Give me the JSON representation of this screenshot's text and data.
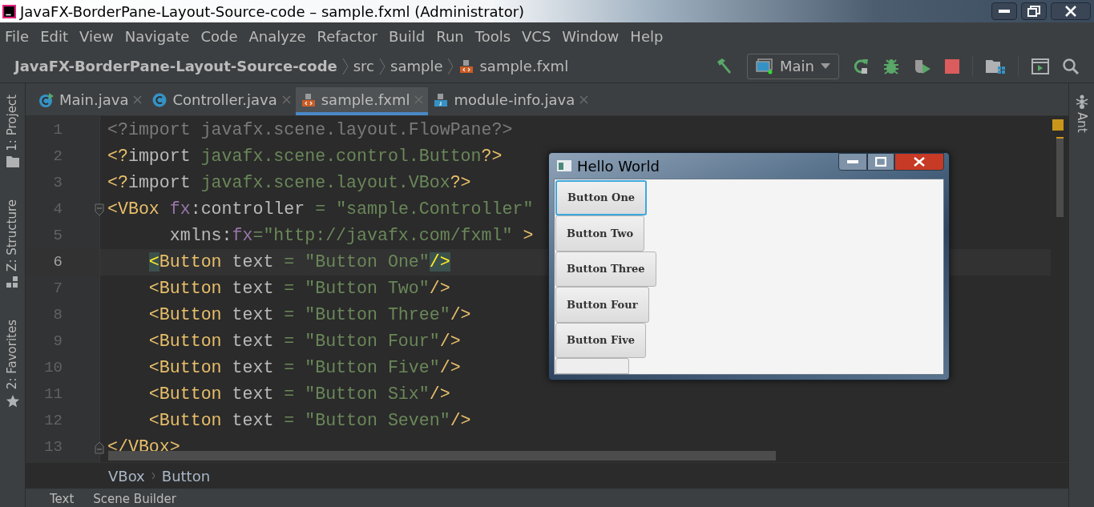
{
  "window": {
    "title": "JavaFX-BorderPane-Layout-Source-code – sample.fxml (Administrator)"
  },
  "menu": [
    "File",
    "Edit",
    "View",
    "Navigate",
    "Code",
    "Analyze",
    "Refactor",
    "Build",
    "Run",
    "Tools",
    "VCS",
    "Window",
    "Help"
  ],
  "navigation": [
    {
      "label": "JavaFX-BorderPane-Layout-Source-code",
      "kind": "project"
    },
    {
      "label": "src",
      "kind": "folder"
    },
    {
      "label": "sample",
      "kind": "folder"
    },
    {
      "label": "sample.fxml",
      "kind": "fxml"
    }
  ],
  "run_config": {
    "label": "Main"
  },
  "tabs": [
    {
      "label": "Main.java",
      "kind": "main",
      "selected": false
    },
    {
      "label": "Controller.java",
      "kind": "class",
      "selected": false
    },
    {
      "label": "sample.fxml",
      "kind": "fxml",
      "selected": true
    },
    {
      "label": "module-info.java",
      "kind": "java",
      "selected": false
    }
  ],
  "tool_windows_left": [
    {
      "label": "1: Project",
      "kind": "folder"
    },
    {
      "label": "Z: Structure",
      "kind": "structure"
    },
    {
      "label": "2: Favorites",
      "kind": "star"
    }
  ],
  "tool_windows_right": [
    {
      "label": "Ant"
    }
  ],
  "editor": {
    "lines": [
      {
        "number": "1",
        "current": false,
        "tokens": [
          {
            "text": "<?import javafx.scene.layout.FlowPane?>",
            "kind": "unused"
          }
        ]
      },
      {
        "number": "2",
        "current": false,
        "tokens": [
          {
            "text": "<?",
            "kind": "tag"
          },
          {
            "text": "import ",
            "kind": "text"
          },
          {
            "text": "javafx.scene.control.Button",
            "kind": "value"
          },
          {
            "text": "?>",
            "kind": "tag"
          }
        ]
      },
      {
        "number": "3",
        "current": false,
        "tokens": [
          {
            "text": "<?",
            "kind": "tag"
          },
          {
            "text": "import ",
            "kind": "text"
          },
          {
            "text": "javafx.scene.layout.VBox",
            "kind": "value"
          },
          {
            "text": "?>",
            "kind": "tag"
          }
        ]
      },
      {
        "number": "4",
        "current": false,
        "fold_start": true,
        "tokens": [
          {
            "text": "<VBox ",
            "kind": "tag"
          },
          {
            "text": "fx",
            "kind": "ns"
          },
          {
            "text": ":controller",
            "kind": "text"
          },
          {
            "text": " = ",
            "kind": "eq"
          },
          {
            "text": "\"sample.Controller\"",
            "kind": "value"
          }
        ]
      },
      {
        "number": "5",
        "current": false,
        "tokens": [
          {
            "text": "      xmlns:",
            "kind": "text"
          },
          {
            "text": "fx",
            "kind": "ns"
          },
          {
            "text": "=",
            "kind": "eq"
          },
          {
            "text": "\"http://javafx.com/fxml\"",
            "kind": "value"
          },
          {
            "text": " >",
            "kind": "tag"
          }
        ]
      },
      {
        "number": "6",
        "current": true,
        "indented": true,
        "tokens": [
          {
            "text": "<",
            "kind": "tag",
            "match": true
          },
          {
            "text": "Button",
            "kind": "tag"
          },
          {
            "text": " text",
            "kind": "text"
          },
          {
            "text": " = ",
            "kind": "eq"
          },
          {
            "text": "\"Button One\"",
            "kind": "value"
          },
          {
            "text": "/>",
            "kind": "tag",
            "match": true
          }
        ]
      },
      {
        "number": "7",
        "current": false,
        "tokens": [
          {
            "text": "    <Button",
            "kind": "tag"
          },
          {
            "text": " text",
            "kind": "text"
          },
          {
            "text": " = ",
            "kind": "eq"
          },
          {
            "text": "\"Button Two\"",
            "kind": "value"
          },
          {
            "text": "/>",
            "kind": "tag"
          }
        ]
      },
      {
        "number": "8",
        "current": false,
        "tokens": [
          {
            "text": "    <Button",
            "kind": "tag"
          },
          {
            "text": " text",
            "kind": "text"
          },
          {
            "text": " = ",
            "kind": "eq"
          },
          {
            "text": "\"Button Three\"",
            "kind": "value"
          },
          {
            "text": "/>",
            "kind": "tag"
          }
        ]
      },
      {
        "number": "9",
        "current": false,
        "tokens": [
          {
            "text": "    <Button",
            "kind": "tag"
          },
          {
            "text": " text",
            "kind": "text"
          },
          {
            "text": " = ",
            "kind": "eq"
          },
          {
            "text": "\"Button Four\"",
            "kind": "value"
          },
          {
            "text": "/>",
            "kind": "tag"
          }
        ]
      },
      {
        "number": "10",
        "current": false,
        "tokens": [
          {
            "text": "    <Button",
            "kind": "tag"
          },
          {
            "text": " text",
            "kind": "text"
          },
          {
            "text": " = ",
            "kind": "eq"
          },
          {
            "text": "\"Button Five\"",
            "kind": "value"
          },
          {
            "text": "/>",
            "kind": "tag"
          }
        ]
      },
      {
        "number": "11",
        "current": false,
        "tokens": [
          {
            "text": "    <Button",
            "kind": "tag"
          },
          {
            "text": " text",
            "kind": "text"
          },
          {
            "text": " = ",
            "kind": "eq"
          },
          {
            "text": "\"Button Six\"",
            "kind": "value"
          },
          {
            "text": "/>",
            "kind": "tag"
          }
        ]
      },
      {
        "number": "12",
        "current": false,
        "tokens": [
          {
            "text": "    <Button",
            "kind": "tag"
          },
          {
            "text": " text",
            "kind": "text"
          },
          {
            "text": " = ",
            "kind": "eq"
          },
          {
            "text": "\"Button Seven\"",
            "kind": "value"
          },
          {
            "text": "/>",
            "kind": "tag"
          }
        ]
      },
      {
        "number": "13",
        "current": false,
        "fold_end": true,
        "tokens": [
          {
            "text": "</VBox>",
            "kind": "tag"
          }
        ]
      }
    ]
  },
  "breadcrumb": [
    "VBox",
    "Button"
  ],
  "bottom_tabs": [
    "Text",
    "Scene Builder"
  ],
  "preview_window": {
    "title": "Hello World",
    "buttons": [
      {
        "label": "Button One",
        "focused": true,
        "kind": "full"
      },
      {
        "label": "Button Two",
        "focused": false,
        "kind": "full"
      },
      {
        "label": "Button Three",
        "focused": false,
        "kind": "full"
      },
      {
        "label": "Button Four",
        "focused": false,
        "kind": "full"
      },
      {
        "label": "Button Five",
        "focused": false,
        "kind": "full"
      },
      {
        "focused": false,
        "kind": "cut"
      }
    ]
  }
}
